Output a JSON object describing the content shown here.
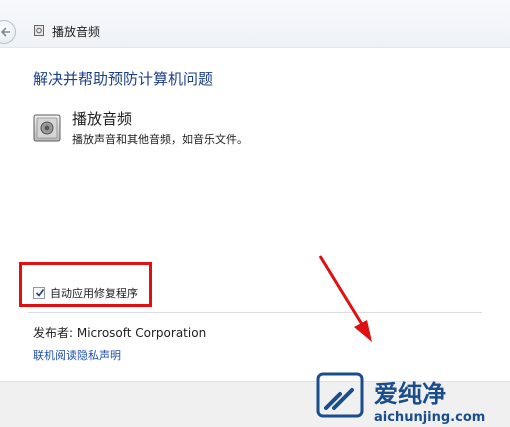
{
  "window": {
    "title": "播放音频"
  },
  "main": {
    "heading": "解决并帮助预防计算机问题",
    "item": {
      "title": "播放音频",
      "description": "播放声音和其他音频，如音乐文件。"
    },
    "auto_repair": {
      "label": "自动应用修复程序",
      "checked": true
    },
    "publisher": "发布者: Microsoft Corporation",
    "privacy_link": "联机阅读隐私声明"
  },
  "watermark": {
    "brand": "爱纯净",
    "url": "aichunjing.com"
  },
  "colors": {
    "heading": "#1c3f8a",
    "link": "#1b4fb1",
    "highlight": "#e01010",
    "watermark": "#1a4d8c"
  }
}
